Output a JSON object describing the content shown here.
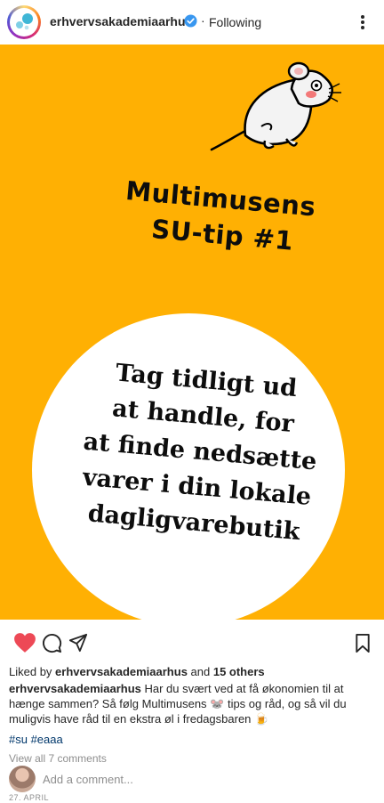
{
  "header": {
    "username": "erhvervsakademiaarhus",
    "separator": "·",
    "follow_label": "Following"
  },
  "post": {
    "background_color": "#FFB003",
    "title_line1": "Multimusens",
    "title_line2": "SU-tip #1",
    "tip_lines": [
      "Tag tidligt ud",
      "at handle, for",
      "at finde nedsætte",
      "varer i din lokale",
      "dagligvarebutik"
    ]
  },
  "actions": {
    "like_icon": "heart-icon",
    "comment_icon": "comment-icon",
    "share_icon": "send-icon",
    "save_icon": "bookmark-icon",
    "liked": true
  },
  "likes": {
    "prefix": "Liked by ",
    "user": "erhvervsakademiaarhus",
    "middle": " and ",
    "count": "15 others"
  },
  "caption": {
    "user": "erhvervsakademiaarhus",
    "text1": " Har du svært ved at få økonomien til at hænge sammen? Så følg Multimusens ",
    "emoji1": "🐭",
    "text2": " tips og råd, og så vil du muligvis have råd til en ekstra øl i fredagsbaren ",
    "emoji2": "🍺"
  },
  "hashtags": "#su #eaaa",
  "comments": {
    "view_all": "View all 7 comments",
    "add_placeholder": "Add a comment..."
  },
  "date": "27. APRIL"
}
